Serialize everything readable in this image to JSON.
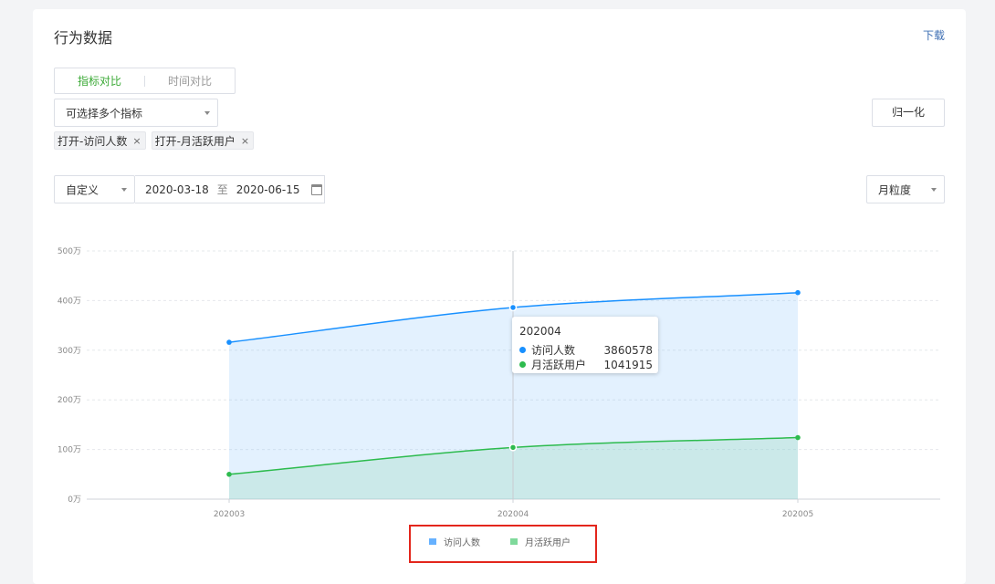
{
  "panel": {
    "title": "行为数据",
    "download_label": "下载"
  },
  "compare_tabs": [
    {
      "label": "指标对比",
      "active": true
    },
    {
      "label": "时间对比",
      "active": false
    }
  ],
  "metric_select": {
    "placeholder": "可选择多个指标"
  },
  "normalize_button": "归一化",
  "selected_tags": [
    "打开-访问人数",
    "打开-月活跃用户"
  ],
  "date_filter": {
    "mode": "自定义",
    "start": "2020-03-18",
    "separator": "至",
    "end": "2020-06-15",
    "granularity": "月粒度"
  },
  "colors": {
    "accent": "#3aa935",
    "link": "#3e6fb3",
    "visitors": "#1890ff",
    "mau": "#2dbb4e",
    "highlight_box": "#e3261c"
  },
  "icons": {
    "calendar": "calendar-icon",
    "dropdown": "caret-down-icon",
    "remove": "close-icon"
  },
  "chart_data": {
    "type": "area",
    "x": [
      "202003",
      "202004",
      "202005"
    ],
    "y_ticks": [
      "0万",
      "100万",
      "200万",
      "300万",
      "400万",
      "500万"
    ],
    "ylim": [
      0,
      5000000
    ],
    "grid": true,
    "legend_position": "bottom",
    "series": [
      {
        "name": "访问人数",
        "values": [
          3160000,
          3860578,
          4160000
        ]
      },
      {
        "name": "月活跃用户",
        "values": [
          500000,
          1041915,
          1240000
        ]
      }
    ]
  },
  "tooltip": {
    "title": "202004",
    "rows": [
      {
        "name": "访问人数",
        "value": "3860578"
      },
      {
        "name": "月活跃用户",
        "value": "1041915"
      }
    ]
  }
}
